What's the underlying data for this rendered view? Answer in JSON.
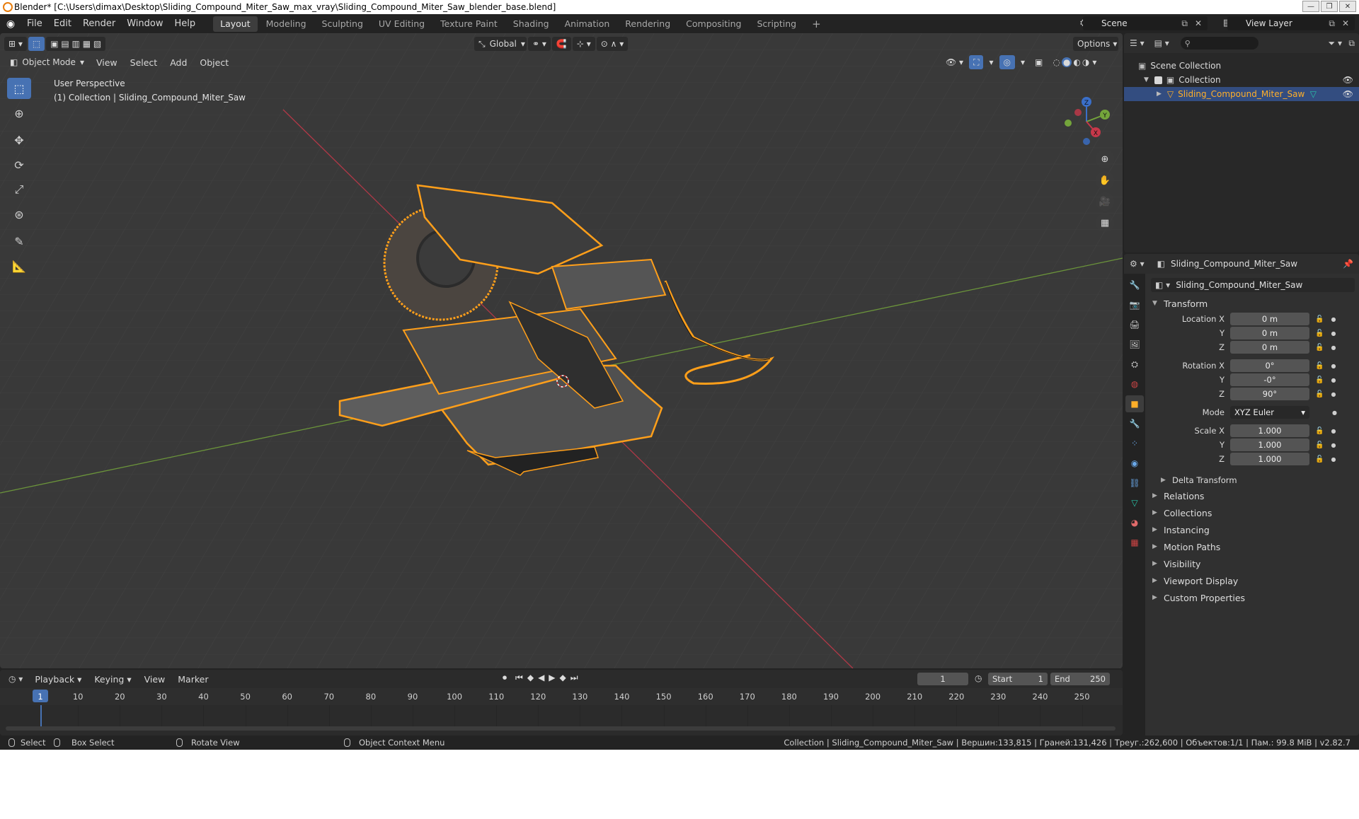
{
  "window": {
    "title": "Blender* [C:\\Users\\dimax\\Desktop\\Sliding_Compound_Miter_Saw_max_vray\\Sliding_Compound_Miter_Saw_blender_base.blend]"
  },
  "menubar": {
    "items": [
      "File",
      "Edit",
      "Render",
      "Window",
      "Help"
    ]
  },
  "workspaces": {
    "tabs": [
      "Layout",
      "Modeling",
      "Sculpting",
      "UV Editing",
      "Texture Paint",
      "Shading",
      "Animation",
      "Rendering",
      "Compositing",
      "Scripting"
    ],
    "active": "Layout",
    "add_symbol": "+"
  },
  "scene": {
    "name": "Scene",
    "view_layer": "View Layer"
  },
  "viewport": {
    "mode": "Object Mode",
    "menus": [
      "View",
      "Select",
      "Add",
      "Object"
    ],
    "orientation": "Global",
    "options_label": "Options",
    "overlay_line1": "User Perspective",
    "overlay_line2": "(1) Collection | Sliding_Compound_Miter_Saw",
    "gizmo": {
      "x": "X",
      "y": "Y",
      "z": "Z"
    }
  },
  "outliner": {
    "scene_collection": "Scene Collection",
    "collection": "Collection",
    "object": "Sliding_Compound_Miter_Saw"
  },
  "properties": {
    "header_object": "Sliding_Compound_Miter_Saw",
    "object_name": "Sliding_Compound_Miter_Saw",
    "transform_title": "Transform",
    "location": {
      "label": "Location X",
      "x": "0 m",
      "y": "0 m",
      "z": "0 m"
    },
    "rotation": {
      "label": "Rotation X",
      "x": "0°",
      "y": "-0°",
      "z": "90°"
    },
    "mode": {
      "label": "Mode",
      "value": "XYZ Euler"
    },
    "scale": {
      "label": "Scale X",
      "x": "1.000",
      "y": "1.000",
      "z": "1.000"
    },
    "axis_y": "Y",
    "axis_z": "Z",
    "delta_transform": "Delta Transform",
    "sections": [
      "Relations",
      "Collections",
      "Instancing",
      "Motion Paths",
      "Visibility",
      "Viewport Display",
      "Custom Properties"
    ]
  },
  "timeline": {
    "menus": [
      "Playback",
      "Keying",
      "View",
      "Marker"
    ],
    "current_frame": "1",
    "start_label": "Start",
    "start": "1",
    "end_label": "End",
    "end": "250",
    "ticks": [
      "1",
      "10",
      "20",
      "30",
      "40",
      "50",
      "60",
      "70",
      "80",
      "90",
      "100",
      "110",
      "120",
      "130",
      "140",
      "150",
      "160",
      "170",
      "180",
      "190",
      "200",
      "210",
      "220",
      "230",
      "240",
      "250"
    ]
  },
  "statusbar": {
    "select": "Select",
    "box_select": "Box Select",
    "rotate_view": "Rotate View",
    "context_menu": "Object Context Menu",
    "stats": "Collection | Sliding_Compound_Miter_Saw | Вершин:133,815 | Граней:131,426 | Треуг.:262,600 | Объектов:1/1 | Пам.: 99.8 MiB | v2.82.7"
  },
  "colors": {
    "accent_blue": "#4772b3",
    "selection_orange": "#ffaf29",
    "viewport_bg": "#393939",
    "x_axis": "#c6384a",
    "y_axis": "#74a53b"
  },
  "icons": [
    "blender-logo-icon",
    "select-box-icon",
    "cursor-icon",
    "move-icon",
    "rotate-icon",
    "scale-icon",
    "transform-icon",
    "annotate-icon",
    "measure-icon",
    "zoom-icon",
    "hand-icon",
    "camera-icon",
    "grid-icon",
    "eye-icon",
    "search-icon",
    "filter-icon",
    "pin-icon",
    "lock-icon"
  ]
}
